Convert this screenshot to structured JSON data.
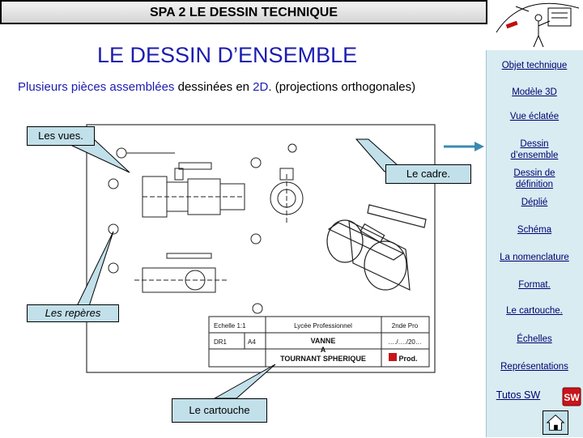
{
  "header": {
    "title": "SPA 2   LE DESSIN TECHNIQUE"
  },
  "main": {
    "title": "LE DESSIN D’ENSEMBLE",
    "subtitle_parts": [
      "Plusieurs pièces assemblées",
      " dessinées en ",
      "2D",
      ". (projections orthogonales)"
    ]
  },
  "callouts": {
    "vues": "Les vues.",
    "cadre": "Le cadre.",
    "reperes": "Les   repères",
    "cartouche": "Le cartouche"
  },
  "sidebar": {
    "items": [
      "Objet technique",
      "Modèle 3D",
      "Vue éclatée",
      "Dessin d’ensemble",
      "Dessin de définition",
      "Déplié",
      "Schéma",
      "La nomenclature",
      "Format.",
      "Le cartouche.",
      "Échelles",
      "Représentations",
      "Tutos SW"
    ]
  },
  "drawing": {
    "cartouche": {
      "echelle": "Echelle 1:1",
      "lycee": "Lycée Professionnel",
      "classe": "2nde Pro",
      "dr": "DR1",
      "format": "A4",
      "date": "…./…./20…",
      "title_lines": [
        "VANNE",
        "A",
        "TOURNANT SPHERIQUE"
      ],
      "prod": "Prod."
    },
    "reperes": [
      "1",
      "2",
      "3",
      "4",
      "5",
      "6",
      "7",
      "8",
      "9",
      "10",
      "11"
    ]
  },
  "colors": {
    "accent": "#1c1cb0",
    "sidebar": "#d8ecf2",
    "callout": "#c2e0ea",
    "arrow": "#3a8ab0"
  },
  "icons": {
    "home": "home-icon",
    "sw": "solidworks-icon"
  }
}
